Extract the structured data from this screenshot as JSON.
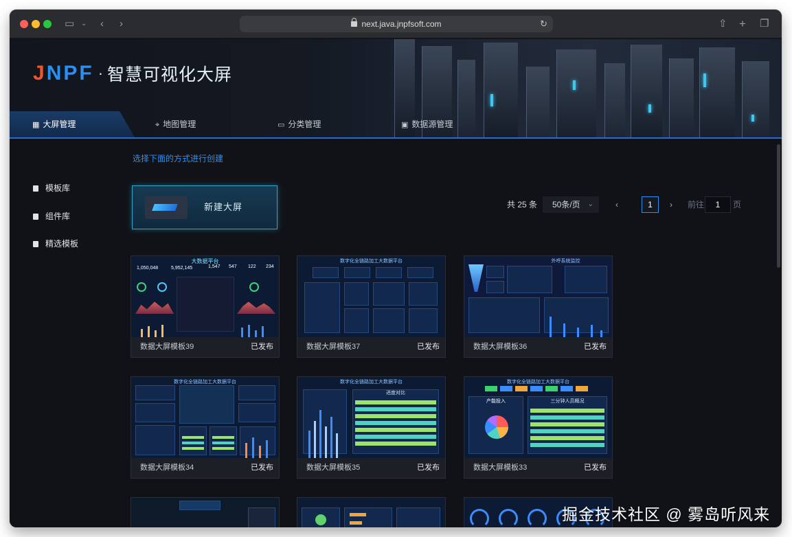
{
  "browser": {
    "url": "next.java.jnpfsoft.com"
  },
  "brand": {
    "logo_text": "JNPF",
    "separator": "·",
    "title": "智慧可视化大屏",
    "logo_colors": {
      "j": "#f0562d",
      "rest": "#2b8ff0"
    }
  },
  "tabs": [
    {
      "label": "大屏管理",
      "icon": "grid-icon",
      "active": true
    },
    {
      "label": "地图管理",
      "icon": "map-pin-icon",
      "active": false
    },
    {
      "label": "分类管理",
      "icon": "folder-icon",
      "active": false
    },
    {
      "label": "数据源管理",
      "icon": "database-icon",
      "active": false
    }
  ],
  "sidebar": {
    "items": [
      {
        "label": "模板库",
        "icon": "clipboard-icon"
      },
      {
        "label": "组件库",
        "icon": "clipboard-icon"
      },
      {
        "label": "精选模板",
        "icon": "clipboard-icon"
      }
    ]
  },
  "main": {
    "create_hint": "选择下面的方式进行创建",
    "new_screen_label": "新建大屏",
    "pagination": {
      "total": "共 25 条",
      "page_size": "50条/页",
      "current_page": "1",
      "goto_prefix": "前往",
      "goto_value": "1",
      "goto_suffix": "页"
    },
    "cards": [
      {
        "name": "数据大屏模板39",
        "status": "已发布"
      },
      {
        "name": "数据大屏模板37",
        "status": "已发布"
      },
      {
        "name": "数据大屏模板36",
        "status": "已发布"
      },
      {
        "name": "数据大屏模板34",
        "status": "已发布"
      },
      {
        "name": "数据大屏模板35",
        "status": "已发布"
      },
      {
        "name": "数据大屏模板33",
        "status": "已发布"
      }
    ],
    "thumb_titles": {
      "c39": "大数据平台",
      "c37": "数字化全链路加工大数据平台",
      "c36": "外呼系统监控",
      "c34": "数字化全链路加工大数据平台",
      "c35": "数字化全链路加工大数据平台",
      "c33": "数字化全链路加工大数据平台",
      "c35_sub": "进度对比",
      "c33_sub": "产能投入",
      "c33_sub2": "三分钟人员概况",
      "c39_n1": "1,050,048",
      "c39_n2": "5,952,145",
      "c39_n3": "1,547",
      "c39_n4": "547",
      "c39_n5": "122",
      "c39_n6": "234"
    }
  },
  "watermark": "掘金技术社区 @ 雾岛听风来",
  "colors": {
    "accent": "#2f8ff0",
    "background": "#101218",
    "card_border": "#2a2e37"
  }
}
